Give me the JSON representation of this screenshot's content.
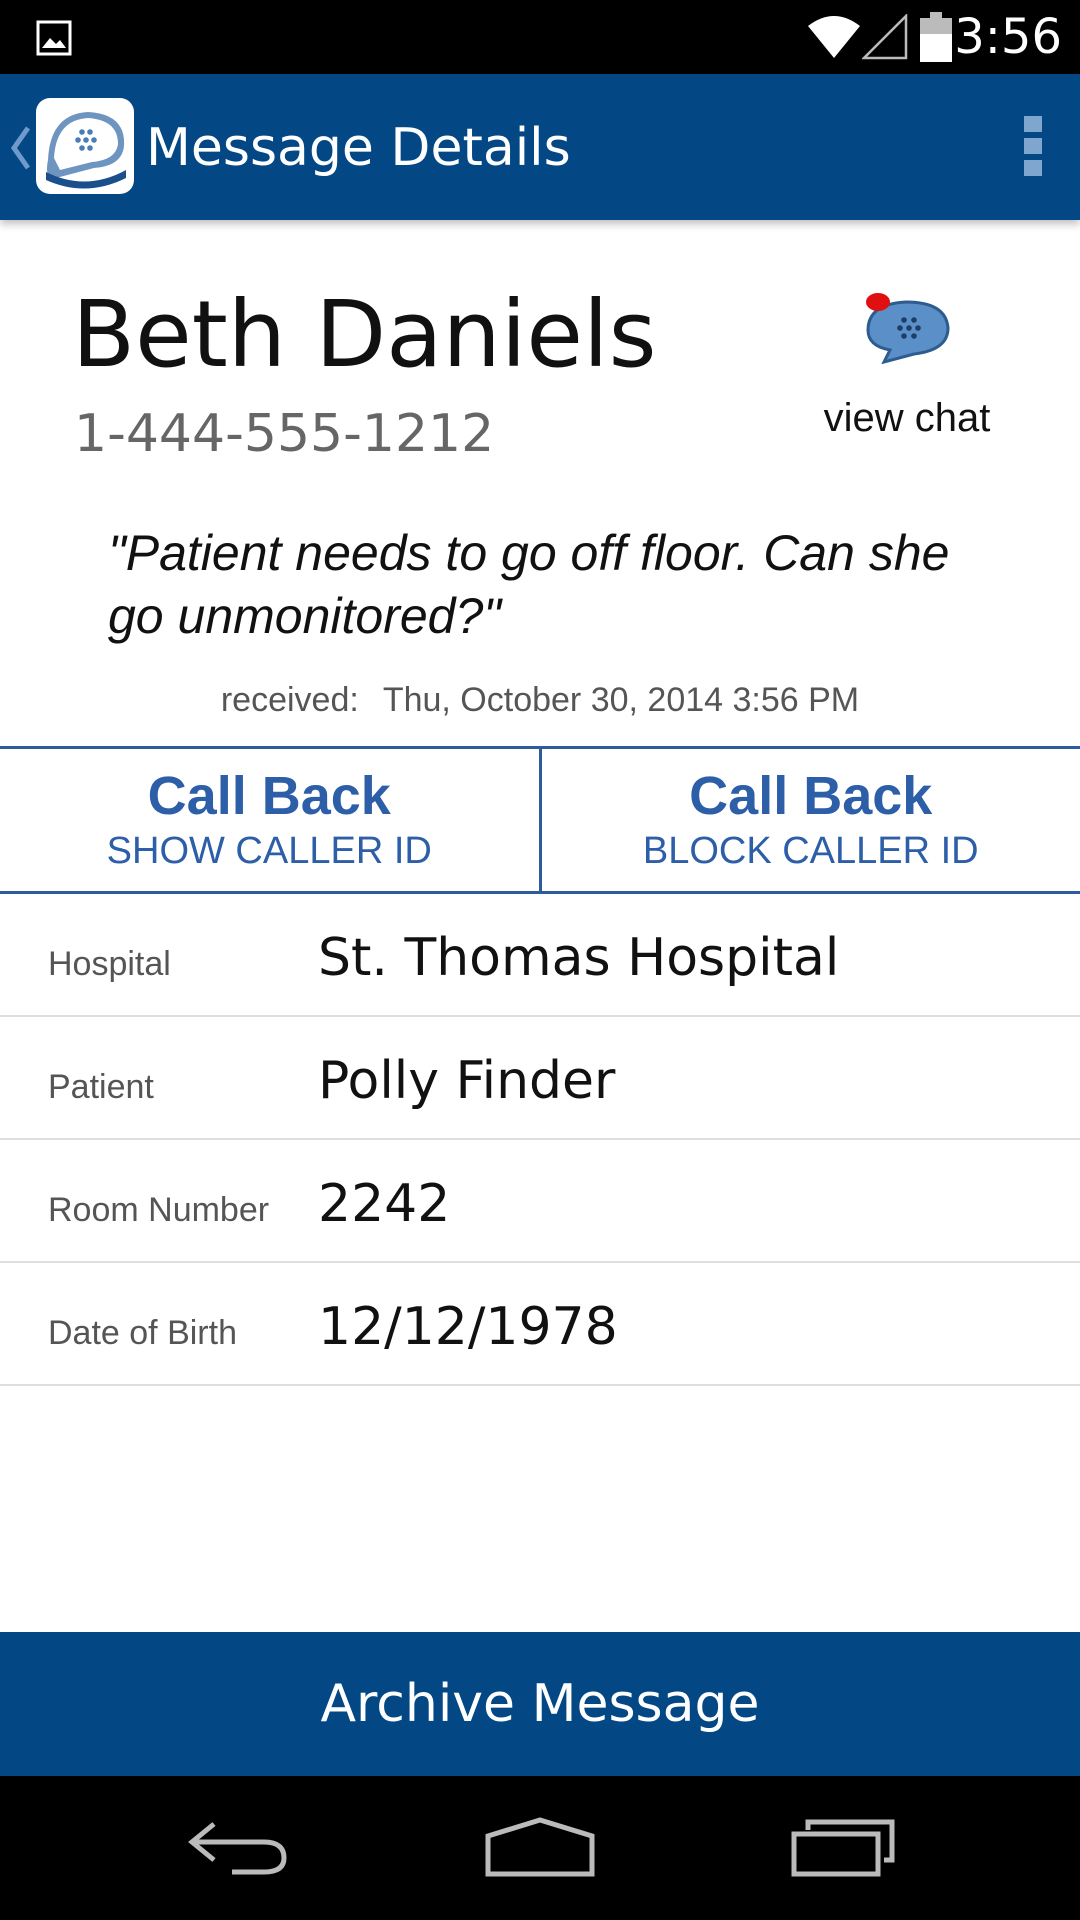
{
  "status_bar": {
    "time": "3:56"
  },
  "app_bar": {
    "title": "Message Details"
  },
  "caller": {
    "name": "Beth Daniels",
    "phone": "1-444-555-1212",
    "view_chat_label": "view chat"
  },
  "message": {
    "text": "\"Patient needs to go off floor.  Can she go unmonitored?\"",
    "received_label": "received:",
    "received_value": "Thu, October 30, 2014 3:56 PM"
  },
  "callback": {
    "show": {
      "label": "Call Back",
      "sublabel": "SHOW CALLER ID"
    },
    "block": {
      "label": "Call Back",
      "sublabel": "BLOCK CALLER ID"
    }
  },
  "details": [
    {
      "label": "Hospital",
      "value": "St. Thomas Hospital"
    },
    {
      "label": "Patient",
      "value": "Polly Finder"
    },
    {
      "label": "Room Number",
      "value": "2242"
    },
    {
      "label": "Date of Birth",
      "value": "12/12/1978"
    }
  ],
  "archive_label": "Archive Message",
  "icons": {
    "notification": "image-notification-icon",
    "wifi": "wifi-icon",
    "signal": "signal-icon",
    "battery": "battery-icon",
    "back": "chevron-left-icon",
    "logo": "app-logo-icon",
    "overflow": "overflow-menu-icon",
    "chat": "chat-bubble-icon",
    "nav_back": "nav-back-icon",
    "nav_home": "nav-home-icon",
    "nav_recents": "nav-recents-icon"
  },
  "colors": {
    "app_bar": "#034885",
    "accent": "#2d5ea8",
    "chat_badge": "#e01010"
  }
}
